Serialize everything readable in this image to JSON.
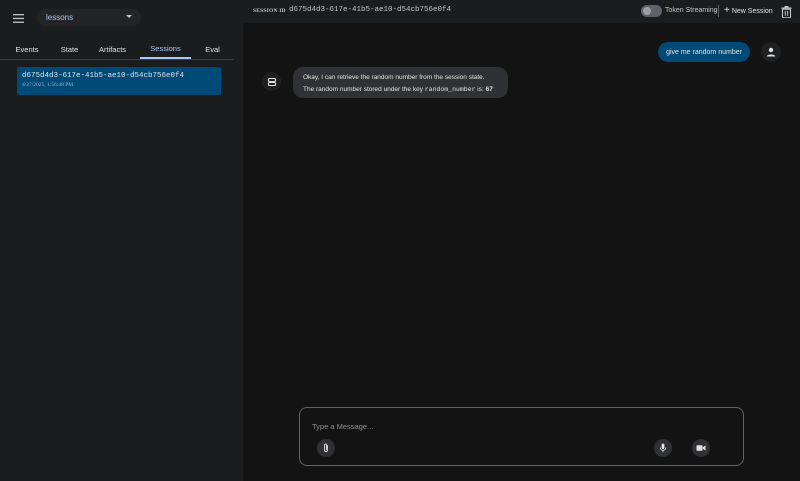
{
  "sidebar": {
    "app_name": "lessons",
    "tabs": [
      {
        "label": "Events"
      },
      {
        "label": "State"
      },
      {
        "label": "Artifacts"
      },
      {
        "label": "Sessions"
      },
      {
        "label": "Eval"
      }
    ],
    "active_tab": "Sessions",
    "sessions": [
      {
        "id": "d675d4d3-617e-41b5-ae10-d54cb756e0f4",
        "date": "4/27/2025, 1:56:48 PM"
      }
    ]
  },
  "topbar": {
    "session_label": "SESSION ID",
    "session_id": "d675d4d3-617e-41b5-ae10-d54cb756e0f4",
    "token_streaming_label": "Token Streaming",
    "token_streaming_on": false,
    "new_session_label": "New Session"
  },
  "chat": {
    "user_message": "give me random number",
    "bot_line1": "Okay, I can retrieve the random number from the session state.",
    "bot_line2_prefix": "The random number stored under the key ",
    "bot_key": "random_number",
    "bot_line2_mid": " is: ",
    "bot_value": "67"
  },
  "input": {
    "placeholder": "Type a Message..."
  },
  "icons": {
    "menu": "menu-icon",
    "trash": "trash-icon",
    "user": "person-icon",
    "bot": "bot-icon",
    "attach": "attach-icon",
    "mic": "mic-icon",
    "video": "video-icon"
  },
  "colors": {
    "accent": "#a8c7fa",
    "selected_bg": "#004a77",
    "bubble_bg": "#303134"
  }
}
